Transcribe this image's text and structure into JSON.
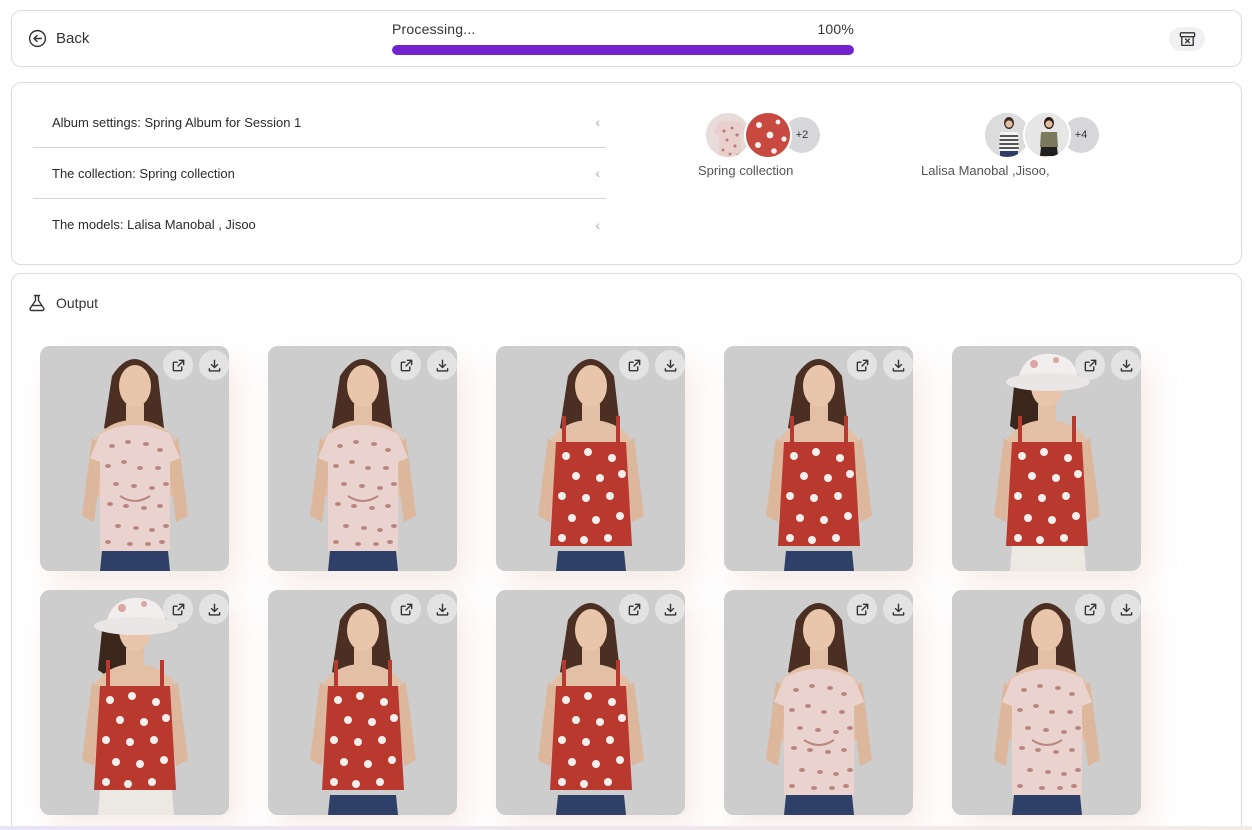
{
  "topbar": {
    "back_label": "Back",
    "status_text": "Processing...",
    "progress_text": "100%",
    "progress_value": 1.0,
    "accent_color": "#7422d0"
  },
  "settings": {
    "rows": [
      {
        "label": "Album settings: Spring Album for Session 1"
      },
      {
        "label": "The collection: Spring collection"
      },
      {
        "label": "The models: Lalisa Manobal , Jisoo"
      }
    ],
    "collection_group": {
      "label": "Spring collection",
      "more": "+2"
    },
    "models_group": {
      "label": "Lalisa Manobal ,Jisoo,",
      "more": "+4"
    }
  },
  "output": {
    "title": "Output",
    "images": [
      {
        "top": "leopard",
        "model": "brunette"
      },
      {
        "top": "leopard",
        "model": "brunette"
      },
      {
        "top": "floral-red",
        "model": "brunette"
      },
      {
        "top": "floral-red",
        "model": "brunette"
      },
      {
        "top": "floral-red",
        "model": "bucket-hat"
      },
      {
        "top": "floral-red",
        "model": "bucket-hat"
      },
      {
        "top": "floral-red",
        "model": "brunette"
      },
      {
        "top": "floral-red",
        "model": "brunette"
      },
      {
        "top": "leopard",
        "model": "brunette"
      },
      {
        "top": "leopard",
        "model": "brunette"
      }
    ]
  }
}
